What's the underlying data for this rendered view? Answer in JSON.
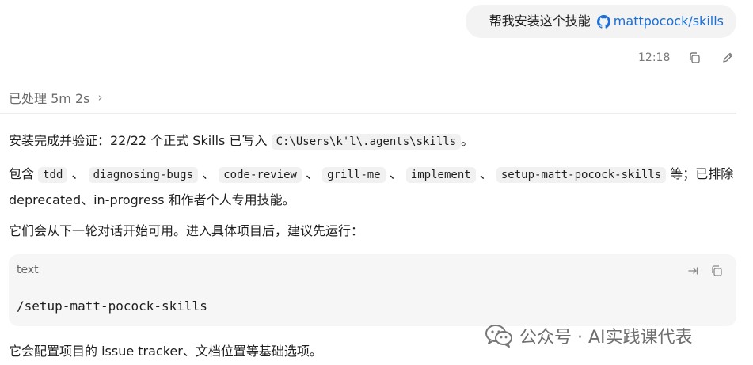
{
  "user_message": {
    "text": "帮我安装这个技能",
    "link_text": "mattpocock/skills",
    "link_icon": "github-icon",
    "link_color": "#1a6fd8"
  },
  "message_meta": {
    "time": "12:18",
    "copy_icon": "copy-icon",
    "edit_icon": "pencil-icon"
  },
  "processing": {
    "label": "已处理 5m 2s",
    "chevron": "›"
  },
  "assistant": {
    "p1": {
      "before": "安装完成并验证：22/22 个正式 Skills 已写入",
      "path": "C:\\Users\\k'l\\.agents\\skills",
      "after": "。"
    },
    "p2": {
      "lead": "包含",
      "skills": [
        "tdd",
        "diagnosing-bugs",
        "code-review",
        "grill-me",
        "implement",
        "setup-matt-pocock-skills"
      ],
      "sep": "、",
      "tail": "等；已排除 deprecated、in-progress 和作者个人专用技能。"
    },
    "p3": "它们会从下一轮对话开始可用。进入具体项目后，建议先运行：",
    "code_block": {
      "language": "text",
      "code": "/setup-matt-pocock-skills"
    },
    "p4": "它会配置项目的 issue tracker、文档位置等基础选项。"
  },
  "watermark": {
    "text": "公众号 · AI实践课代表",
    "icon": "wechat-icon"
  }
}
